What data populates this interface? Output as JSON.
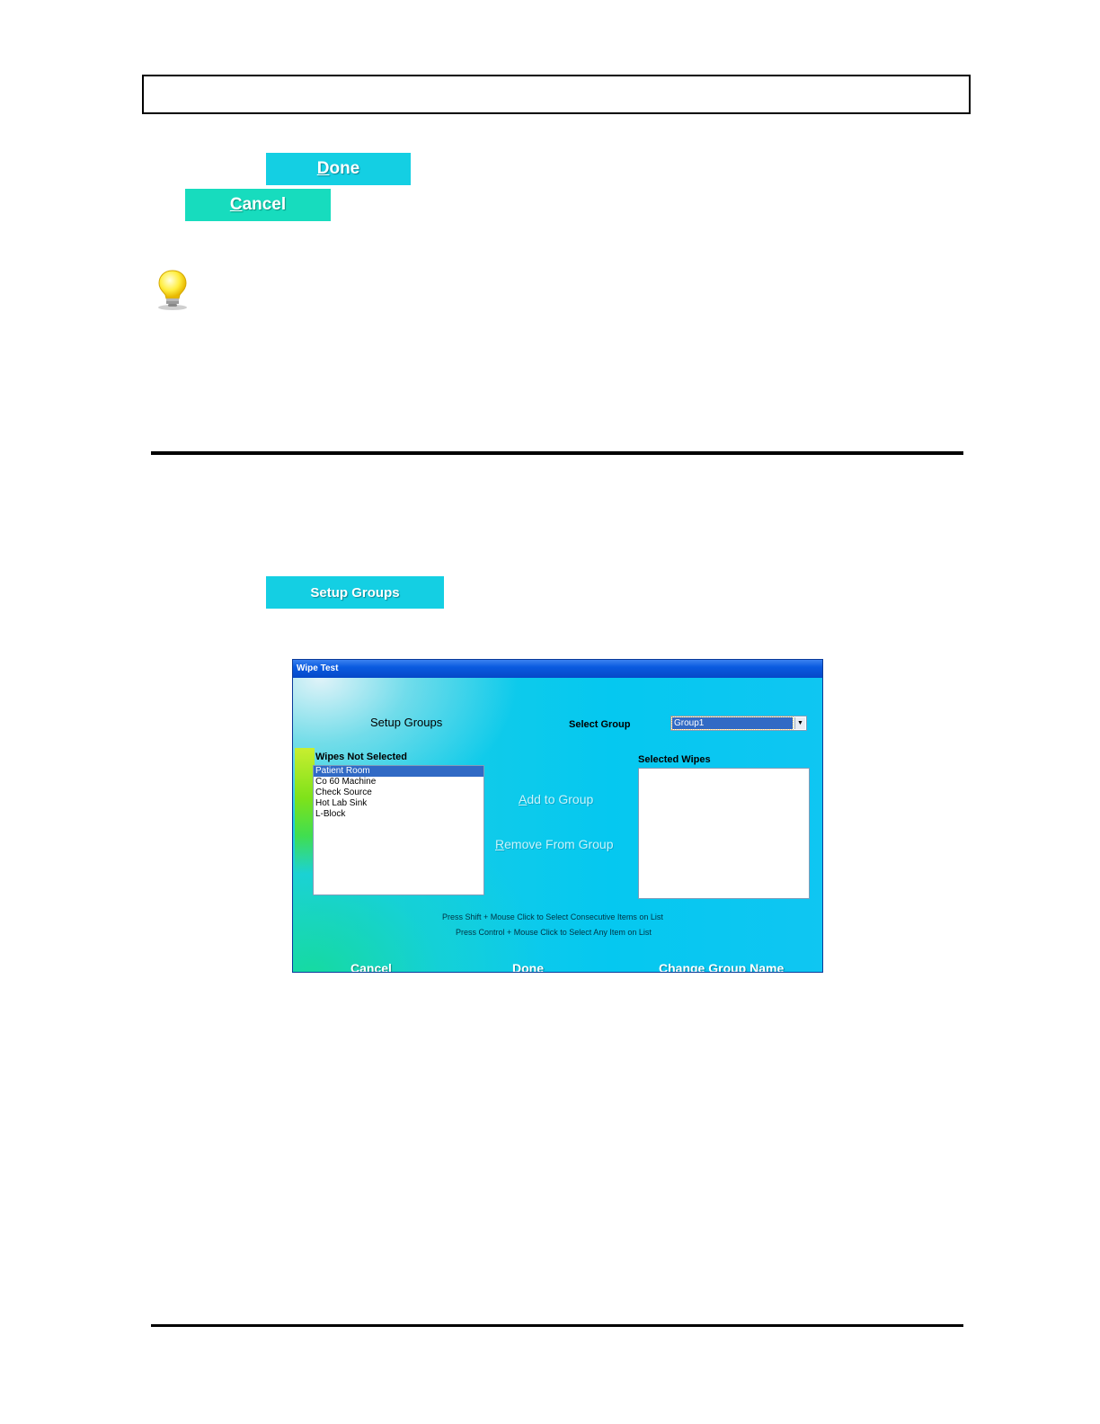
{
  "page": {
    "done_button": {
      "accel": "D",
      "rest": "one"
    },
    "cancel_button": {
      "accel": "C",
      "rest": "ancel"
    },
    "setup_groups_button": "Setup Groups",
    "tip_icon": "lightbulb-icon"
  },
  "dialog": {
    "title": "Wipe Test",
    "heading": "Setup Groups",
    "select_group_label": "Select Group",
    "select_group_value": "Group1",
    "wipes_not_selected_label": "Wipes Not Selected",
    "selected_wipes_label": "Selected Wipes",
    "wipes_not_selected": [
      {
        "label": "Patient Room",
        "selected": true
      },
      {
        "label": "Co 60 Machine",
        "selected": false
      },
      {
        "label": "Check Source",
        "selected": false
      },
      {
        "label": "Hot Lab Sink",
        "selected": false
      },
      {
        "label": "L-Block",
        "selected": false
      }
    ],
    "selected_wipes": [],
    "add_to_group": {
      "accel": "A",
      "rest": "dd to Group"
    },
    "remove_from_group": {
      "accel": "R",
      "rest": "emove From Group"
    },
    "hint_shift": "Press Shift + Mouse Click to Select Consecutive Items on List",
    "hint_control": "Press Control + Mouse Click to Select Any Item on List",
    "cancel": {
      "accel": "C",
      "rest": "ancel"
    },
    "done": {
      "accel": "D",
      "rest": "one"
    },
    "change_group_name": {
      "pre": "Change Group ",
      "accel": "N",
      "rest": "ame"
    }
  },
  "colors": {
    "button_cyan": "#14cfe3",
    "button_teal": "#17dcbe",
    "titlebar_blue": "#0a5be0",
    "selection_blue": "#316ac5"
  }
}
